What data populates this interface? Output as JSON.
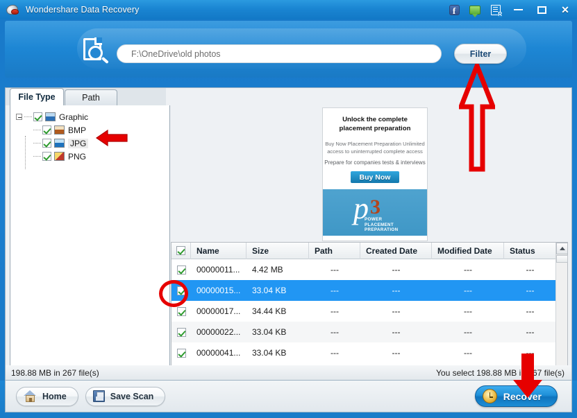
{
  "window": {
    "title": "Wondershare Data Recovery",
    "logo_icon": "wondershare-logo-icon",
    "titlebar_icons": [
      {
        "name": "facebook-icon",
        "glyph": "f"
      },
      {
        "name": "feedback-chat-icon",
        "glyph": ""
      },
      {
        "name": "register-icon",
        "glyph": ""
      }
    ],
    "minimize_label": "",
    "maximize_label": "",
    "close_label": "✕"
  },
  "search": {
    "icon": "document-search-icon",
    "path_value": "F:\\OneDrive\\old photos",
    "path_placeholder": "F:\\OneDrive\\old photos",
    "filter_label": "Filter"
  },
  "tabs": [
    {
      "name": "tab-file-type",
      "label": "File Type",
      "active": true
    },
    {
      "name": "tab-path",
      "label": "Path",
      "active": false
    }
  ],
  "tree": {
    "root": {
      "label": "Graphic",
      "icon": "graphic-file-icon",
      "checked": true
    },
    "children": [
      {
        "label": "BMP",
        "icon": "bmp-file-icon",
        "checked": true
      },
      {
        "label": "JPG",
        "icon": "jpg-file-icon",
        "checked": true,
        "highlighted": true
      },
      {
        "label": "PNG",
        "icon": "png-file-icon",
        "checked": true
      }
    ]
  },
  "view_modes": [
    {
      "name": "view-thumbnails-button",
      "icon": "grid-view-icon",
      "active": false
    },
    {
      "name": "view-list-button",
      "icon": "list-view-icon",
      "active": false
    },
    {
      "name": "view-preview-button",
      "icon": "preview-view-icon",
      "active": true
    }
  ],
  "advertisement": {
    "headline": "Unlock the complete placement preparation",
    "body": "Buy Now Placement Preparation Unlimited access to uninterrupted complete access",
    "subtext": "Prepare for companies tests & interviews",
    "cta_label": "Buy Now",
    "brand_letter": "p",
    "brand_number": "3",
    "brand_lines": "POWER\nPLACEMENT\nPREPARATION"
  },
  "table": {
    "select_all_checked": true,
    "columns": [
      "Name",
      "Size",
      "Path",
      "Created Date",
      "Modified Date",
      "Status"
    ],
    "rows": [
      {
        "checked": true,
        "name": "00000011...",
        "size": "4.42 MB",
        "path": "---",
        "created": "---",
        "modified": "---",
        "status": "---",
        "selected": false
      },
      {
        "checked": true,
        "name": "00000015...",
        "size": "33.04 KB",
        "path": "---",
        "created": "---",
        "modified": "---",
        "status": "---",
        "selected": true
      },
      {
        "checked": true,
        "name": "00000017...",
        "size": "34.44 KB",
        "path": "---",
        "created": "---",
        "modified": "---",
        "status": "---",
        "selected": false
      },
      {
        "checked": true,
        "name": "00000022...",
        "size": "33.04 KB",
        "path": "---",
        "created": "---",
        "modified": "---",
        "status": "---",
        "selected": false
      },
      {
        "checked": true,
        "name": "00000041...",
        "size": "33.04 KB",
        "path": "---",
        "created": "---",
        "modified": "---",
        "status": "---",
        "selected": false
      }
    ]
  },
  "status_bar": {
    "left": "198.88 MB in 267 file(s)",
    "right": "You select 198.88 MB in 267 file(s)"
  },
  "footer": {
    "home_label": "Home",
    "save_scan_label": "Save Scan",
    "recover_label": "Recover"
  },
  "annotations": {
    "accent_color": "#e60000",
    "arrow_to_jpg": "left-arrow pointing at JPG tree item",
    "arrow_to_filter": "up-arrow pointing at Filter button",
    "arrow_to_recover": "down-arrow pointing at Recover button",
    "circle_on_checkbox": "ellipse around selected row checkbox"
  }
}
